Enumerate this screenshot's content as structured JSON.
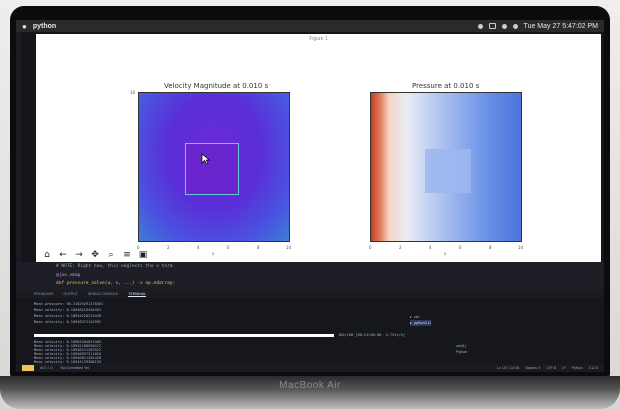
{
  "menubar": {
    "app": "python",
    "clock": "Tue May 27  5:47:02 PM"
  },
  "figure": {
    "window_title": "Figure 1",
    "left_title": "Velocity Magnitude at 0.010 s",
    "right_title": "Pressure at 0.010 s",
    "left_ticks_y": [
      "10",
      "",
      "",
      "",
      "",
      ""
    ],
    "left_ticks_x": [
      "0",
      "2",
      "4",
      "6",
      "8",
      "10"
    ],
    "right_ticks_x": [
      "0",
      "2",
      "4",
      "6",
      "8",
      "10"
    ],
    "left_xlabel": "x",
    "right_xlabel": "x"
  },
  "toolbar": {
    "home_icon": "home-icon",
    "back_icon": "back-icon",
    "forward_icon": "forward-icon",
    "pan_icon": "pan-icon",
    "zoom_icon": "zoom-icon",
    "configure_icon": "configure-icon",
    "save_icon": "save-icon"
  },
  "editor": {
    "line1": "# NOTE: Right now, this neglects the ν term",
    "line2": "@jax.vmap",
    "line3": "def pressure_solve(u, v, ...) -> np.ndarray:"
  },
  "panel": {
    "tabs": [
      "PROBLEMS",
      "OUTPUT",
      "DEBUG CONSOLE",
      "TERMINAL"
    ],
    "active_tab": "TERMINAL"
  },
  "terminal": {
    "lines": [
      "Mean pressure: 96.21829291178361",
      "Mean velocity: 0.10946219420491",
      "Mean velocity: 0.10934220219449",
      "Mean velocity: 0.10948371124992"
    ],
    "progress_label": "100/100  [00:21<00:00,  4.73it/s]",
    "progress_value": 1.0,
    "lines2": [
      "Mean velocity: 0.10983284023485",
      "Mean velocity: 0.10942188930472",
      "Mean velocity: 0.10938211203922",
      "Mean velocity: 0.10940037311054",
      "Mean velocity: 0.10946811204428",
      "Mean velocity: 0.10944129308133"
    ],
    "sessions": [
      "zsh",
      "python3.11"
    ],
    "sessions2": [
      "zsh(1)",
      "Python"
    ]
  },
  "statusbar": {
    "left": [
      "⊗ 0  ⚠ 0",
      "Not Committed Yet"
    ],
    "right": [
      "Ln 107, Col 26",
      "Spaces: 4",
      "UTF-8",
      "LF",
      "Python",
      "3.12.8"
    ]
  }
}
